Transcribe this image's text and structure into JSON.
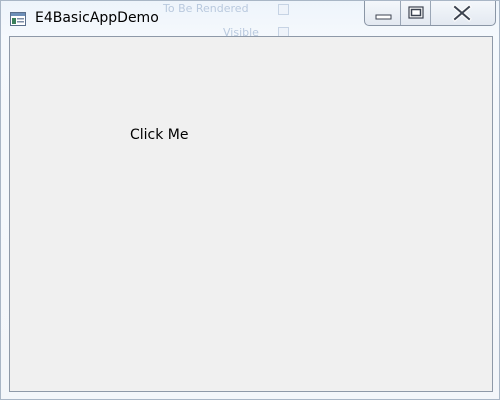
{
  "window": {
    "title": "E4BasicAppDemo"
  },
  "background_window": {
    "line1": "To Be Rendered",
    "line2": "Visible"
  },
  "caption_buttons": {
    "minimize_icon": "minimize-icon",
    "maximize_icon": "maximize-icon",
    "close_icon": "close-icon"
  },
  "content": {
    "click_label": "Click Me"
  },
  "colors": {
    "client_background": "#f0f0f0",
    "frame_border": "#8e99a8"
  }
}
